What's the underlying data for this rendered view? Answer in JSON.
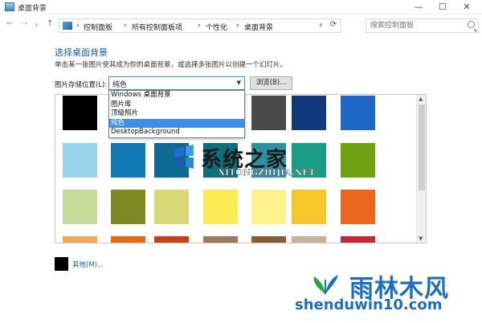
{
  "window": {
    "title": "桌面背景",
    "min": "—",
    "max": "☐",
    "close": "✕"
  },
  "nav": {
    "back": "←",
    "forward": "→",
    "dropdown": "∨",
    "up": "↑",
    "breadcrumbs": [
      "控制面板",
      "所有控制面板项",
      "个性化",
      "桌面背景"
    ],
    "separator": "›",
    "search_placeholder": "搜索控制面板"
  },
  "main": {
    "heading": "选择桌面背景",
    "subtext": "单击某一张图片使其成为你的桌面背景，或选择多张图片以创建一个幻灯片。",
    "location_label": "图片存储位置(L):",
    "location_value": "纯色",
    "browse_label": "浏览(B)...",
    "dropdown_options": [
      "Windows 桌面背景",
      "图片库",
      "顶级照片",
      "纯色",
      "DesktopBackground"
    ],
    "selected_option_index": 3,
    "other_label": "其他(M)..."
  },
  "swatch_colors": [
    [
      "#000000",
      "#6d6d6d",
      "#e8e8e8",
      "#ffffff",
      "#4a4a4a",
      "#10397b",
      "#1e67c4"
    ],
    [
      "#9ad4ea",
      "#1179b4",
      "#0f6a8f",
      "#0d6f7a",
      "#2f8fa0",
      "#1b9d84",
      "#6ea213"
    ],
    [
      "#c7dc98",
      "#7f8a24",
      "#d8d978",
      "#fbea54",
      "#fef38c",
      "#f8c62b",
      "#eb6720"
    ],
    [
      "#f5a65a",
      "#e76a11",
      "#c54417",
      "#a0775f",
      "#8c5c32",
      "#c7b39a",
      "#c42a3b"
    ]
  ],
  "watermark": {
    "title": "系统之家",
    "subtitle": "XITONGZHIJIA.NET",
    "brand": "雨林木风",
    "url": "shenduwin10.com"
  },
  "colors": {
    "accent": "#1e5aa8",
    "selection": "#3c8ee8"
  }
}
